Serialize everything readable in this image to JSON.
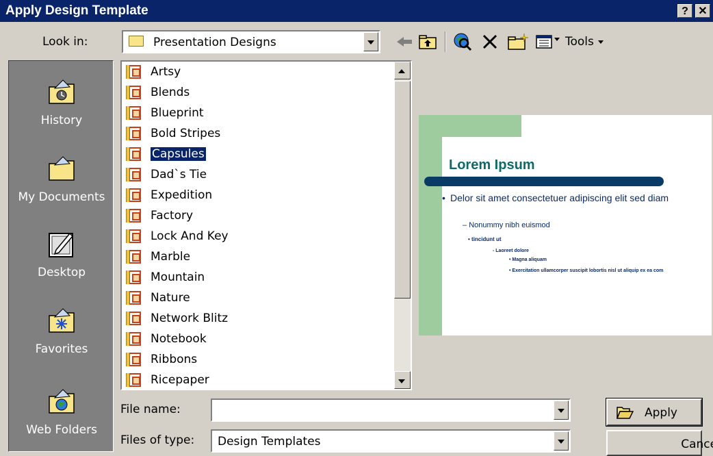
{
  "window": {
    "title": "Apply Design Template",
    "help_label": "?",
    "close_label": "✕"
  },
  "look_in": {
    "label": "Look in:",
    "value": "Presentation Designs"
  },
  "toolbar": {
    "tools_label": "Tools"
  },
  "places": [
    {
      "label": "History",
      "icon": "history-icon"
    },
    {
      "label": "My Documents",
      "icon": "my-documents-icon"
    },
    {
      "label": "Desktop",
      "icon": "desktop-icon"
    },
    {
      "label": "Favorites",
      "icon": "favorites-icon"
    },
    {
      "label": "Web Folders",
      "icon": "web-folders-icon"
    }
  ],
  "files": {
    "selected": "Capsules",
    "items": [
      "Artsy",
      "Blends",
      "Blueprint",
      "Bold Stripes",
      "Capsules",
      "Dad`s Tie",
      "Expedition",
      "Factory",
      "Lock And Key",
      "Marble",
      "Mountain",
      "Nature",
      "Network Blitz",
      "Notebook",
      "Ribbons",
      "Ricepaper"
    ]
  },
  "preview": {
    "title": "Lorem Ipsum",
    "bullet1": "Delor sit amet consectetuer adipiscing elit sed diam",
    "bullet2": "Nonummy nibh euismod",
    "bullet3": "tincidunt ut",
    "bullet4": "Laoreet dolore",
    "bullet5": "Magna aliquam",
    "bullet6": "Exercitation ullamcorper suscipit lobortis nisl ut aliquip ex ea com",
    "colors": {
      "accent_green": "#9ecc9e",
      "title_teal": "#0b6a6a",
      "bar_navy": "#0a3a66"
    }
  },
  "file_name": {
    "label": "File name:",
    "value": ""
  },
  "files_of_type": {
    "label": "Files of type:",
    "value": "Design Templates"
  },
  "buttons": {
    "apply": "Apply",
    "cancel": "Cancel"
  }
}
